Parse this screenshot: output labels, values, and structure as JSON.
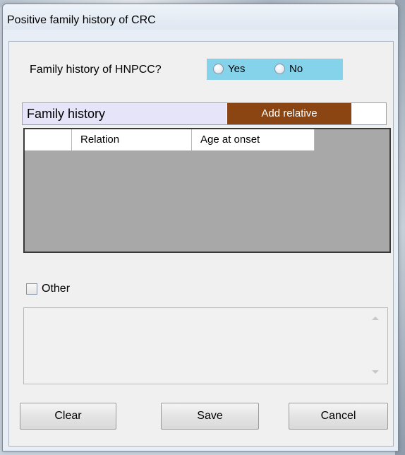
{
  "window": {
    "title": "Positive family history of CRC"
  },
  "question": {
    "label": "Family history of HNPCC?",
    "options": [
      "Yes",
      "No"
    ]
  },
  "family_history": {
    "title": "Family history",
    "add_button": "Add relative",
    "columns": [
      "",
      "Relation",
      "Age at onset"
    ]
  },
  "other": {
    "label": "Other"
  },
  "buttons": {
    "clear": "Clear",
    "save": "Save",
    "cancel": "Cancel"
  },
  "colors": {
    "radio_panel": "#85d3ea",
    "section_header": "#e6e4f8",
    "add_button": "#8b4513",
    "grid_background": "#a8a8a8"
  }
}
